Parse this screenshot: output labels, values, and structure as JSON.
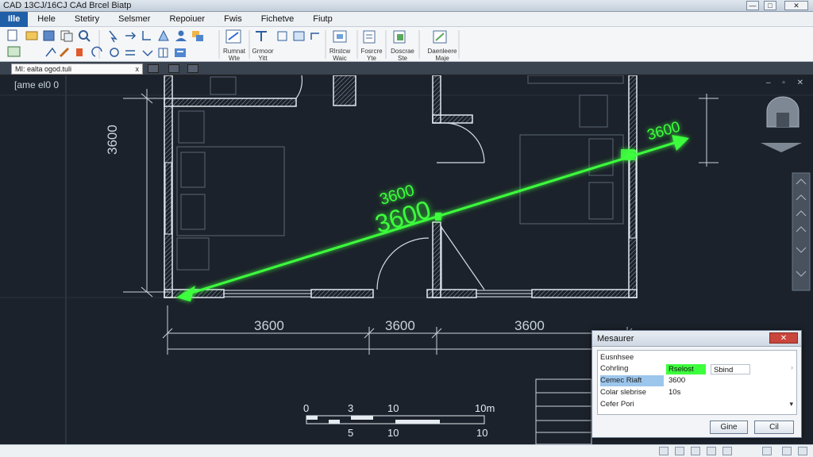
{
  "window": {
    "title": "CAD 13CJ/16CJ CAd Brcel Biatp",
    "controls": [
      "—",
      "□",
      "✕"
    ]
  },
  "menu": [
    "Ille",
    "Hele",
    "Stetiry",
    "Selsmer",
    "Repoiuer",
    "Fwis",
    "Fichetve",
    "Fiutp"
  ],
  "ribbon": {
    "labels": [
      "Rumnat\nWte",
      "Grmoor\nYitt",
      "Rlrstcw\nWaic",
      "Fosrcre\nYte",
      "Doscrae\nSte",
      "Daenleere\nMaje"
    ]
  },
  "document_tab": {
    "label": "MI: ealta ogod.tuli",
    "close": "x"
  },
  "viewport": {
    "label": "[ame el0 0",
    "controls": "– ▫ ✕"
  },
  "drawing": {
    "dim_vertical": "3600",
    "dims_bottom": [
      "3600",
      "3600",
      "3600"
    ],
    "measure_small": "3600",
    "measure_big": "3600",
    "measure_end": "3600",
    "scale_top": [
      "0",
      "3",
      "10",
      "10m"
    ],
    "scale_bottom": [
      "5",
      "10",
      "10"
    ],
    "accent_color": "#3dff3d"
  },
  "measure_dialog": {
    "title": "Mesaurer",
    "close": "✕",
    "rows": [
      {
        "label": "Eusnhsee",
        "value": ""
      },
      {
        "label": "Cohrling",
        "value": "Rselost",
        "value2": "Sbind"
      },
      {
        "label": "Cemec Riaft",
        "value": "3600"
      },
      {
        "label": "Colar slebrise",
        "value": "10s"
      },
      {
        "label": "Cefer Pori",
        "value": ""
      }
    ],
    "ok_button": "Gine",
    "cancel_button": "Cil"
  }
}
